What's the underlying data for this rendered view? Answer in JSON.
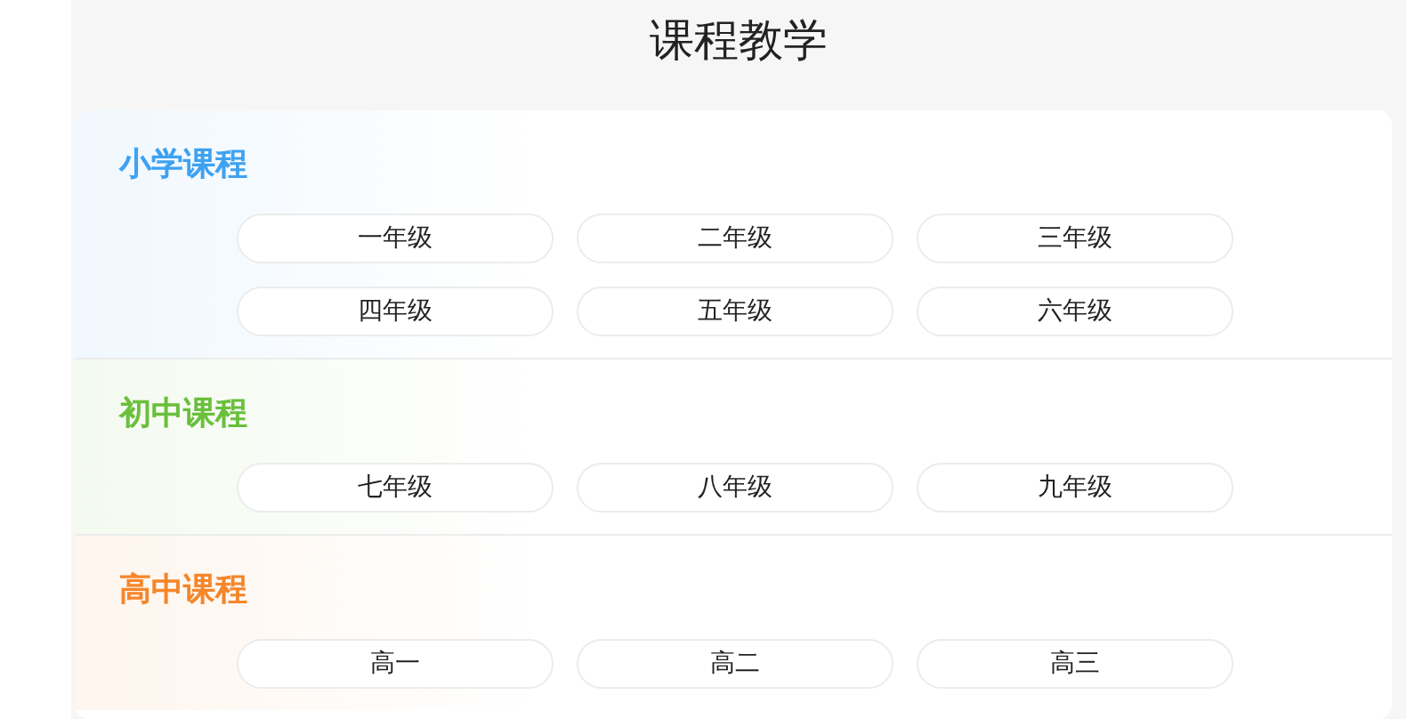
{
  "page": {
    "title": "课程教学"
  },
  "sections": [
    {
      "title": "小学课程",
      "color": "#3ea2f2",
      "grades": [
        "一年级",
        "二年级",
        "三年级",
        "四年级",
        "五年级",
        "六年级"
      ]
    },
    {
      "title": "初中课程",
      "color": "#6abf3b",
      "grades": [
        "七年级",
        "八年级",
        "九年级"
      ]
    },
    {
      "title": "高中课程",
      "color": "#f5862a",
      "grades": [
        "高一",
        "高二",
        "高三"
      ]
    }
  ]
}
